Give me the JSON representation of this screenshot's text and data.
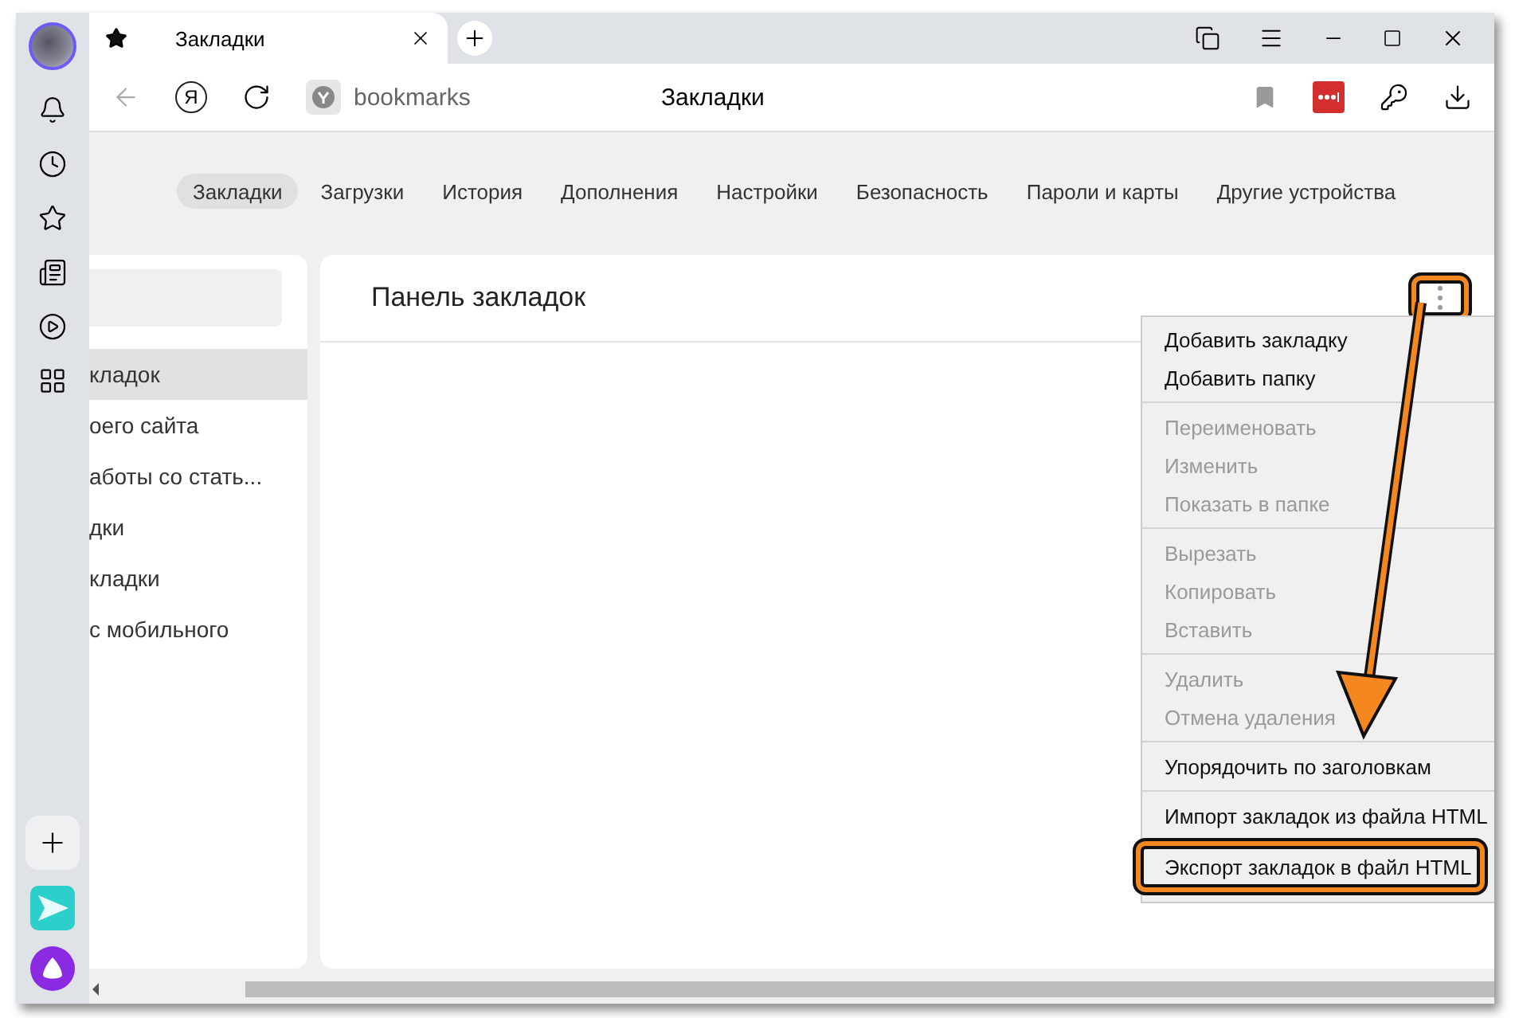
{
  "tab": {
    "title": "Закладки",
    "selected": true
  },
  "address_bar": {
    "logo_letter": "Я",
    "url": "bookmarks",
    "page_title": "Закладки",
    "back_disabled": true
  },
  "nav_tabs": [
    {
      "label": "Закладки",
      "selected": true
    },
    {
      "label": "Загрузки",
      "selected": false
    },
    {
      "label": "История",
      "selected": false
    },
    {
      "label": "Дополнения",
      "selected": false
    },
    {
      "label": "Настройки",
      "selected": false
    },
    {
      "label": "Безопасность",
      "selected": false
    },
    {
      "label": "Пароли и карты",
      "selected": false
    },
    {
      "label": "Другие устройства",
      "selected": false
    }
  ],
  "folders": [
    {
      "label": "кладок",
      "selected": true
    },
    {
      "label": "оего сайта",
      "selected": false
    },
    {
      "label": "аботы со стать...",
      "selected": false
    },
    {
      "label": "дки",
      "selected": false
    },
    {
      "label": "кладки",
      "selected": false
    },
    {
      "label": "с мобильного",
      "selected": false
    }
  ],
  "panel": {
    "title": "Панель закладок",
    "menu_button_highlighted": true
  },
  "context_menu": [
    {
      "kind": "item",
      "label": "Добавить закладку",
      "disabled": false,
      "highlighted": false
    },
    {
      "kind": "item",
      "label": "Добавить папку",
      "disabled": false,
      "highlighted": false
    },
    {
      "kind": "separator"
    },
    {
      "kind": "item",
      "label": "Переименовать",
      "disabled": true,
      "highlighted": false
    },
    {
      "kind": "item",
      "label": "Изменить",
      "disabled": true,
      "highlighted": false
    },
    {
      "kind": "item",
      "label": "Показать в папке",
      "disabled": true,
      "highlighted": false
    },
    {
      "kind": "separator"
    },
    {
      "kind": "item",
      "label": "Вырезать",
      "disabled": true,
      "highlighted": false
    },
    {
      "kind": "item",
      "label": "Копировать",
      "disabled": true,
      "highlighted": false
    },
    {
      "kind": "item",
      "label": "Вставить",
      "disabled": true,
      "highlighted": false
    },
    {
      "kind": "separator"
    },
    {
      "kind": "item",
      "label": "Удалить",
      "disabled": true,
      "highlighted": false
    },
    {
      "kind": "item",
      "label": "Отмена удаления",
      "disabled": true,
      "highlighted": false
    },
    {
      "kind": "separator"
    },
    {
      "kind": "item",
      "label": "Упорядочить по заголовкам",
      "disabled": false,
      "highlighted": false
    },
    {
      "kind": "separator"
    },
    {
      "kind": "item",
      "label": "Импорт закладок из файла HTML",
      "disabled": false,
      "highlighted": false
    },
    {
      "kind": "item",
      "label": "Экспорт закладок в файл HTML",
      "disabled": false,
      "highlighted": true
    }
  ],
  "annotation_arrow": true
}
